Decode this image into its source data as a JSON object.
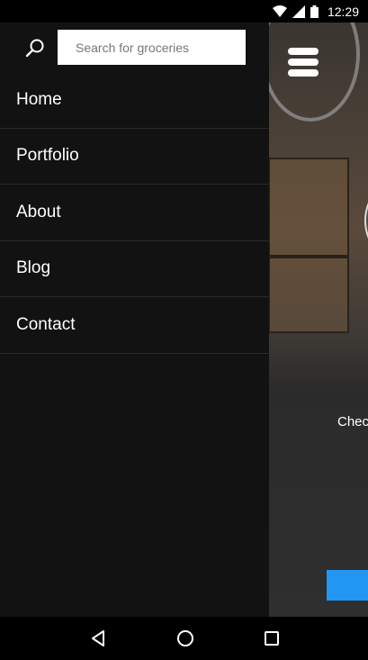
{
  "status_bar": {
    "time": "12:29",
    "icons": [
      "wifi-icon",
      "signal-icon",
      "battery-icon"
    ]
  },
  "drawer": {
    "search": {
      "placeholder": "Search for groceries",
      "value": ""
    },
    "items": [
      {
        "label": "Home"
      },
      {
        "label": "Portfolio"
      },
      {
        "label": "About"
      },
      {
        "label": "Blog"
      },
      {
        "label": "Contact"
      }
    ]
  },
  "background": {
    "partial_text": "Chec",
    "button_color": "#2196f3"
  },
  "nav_bar": {
    "icons": [
      "back-icon",
      "home-icon",
      "recents-icon"
    ]
  },
  "colors": {
    "drawer_bg": "#121212",
    "divider": "#2a2a2a",
    "accent": "#2196f3"
  }
}
